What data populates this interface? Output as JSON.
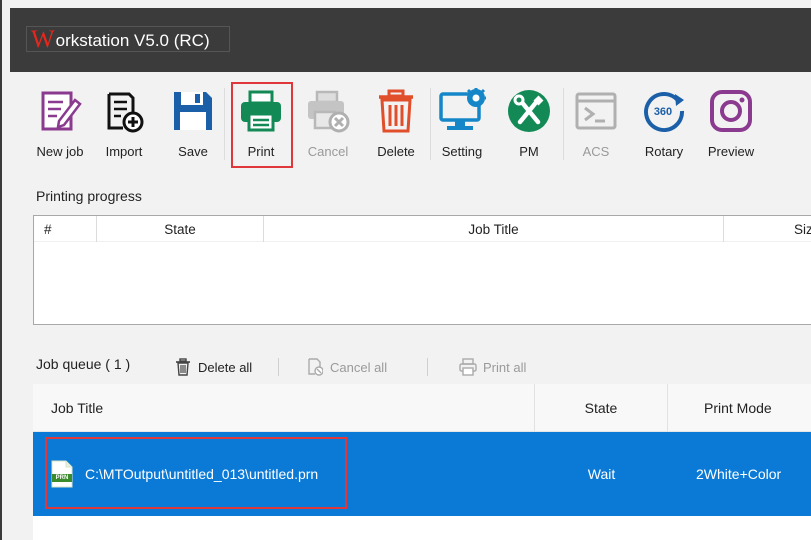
{
  "window": {
    "title_initial": "W",
    "title_rest": "orkstation V5.0 (RC)"
  },
  "toolbar": {
    "items": [
      {
        "label": "New job",
        "icon": "new-job-icon",
        "enabled": true
      },
      {
        "label": "Import",
        "icon": "import-icon",
        "enabled": true
      },
      {
        "label": "Save",
        "icon": "save-icon",
        "enabled": true
      },
      {
        "label": "Print",
        "icon": "printer-icon",
        "enabled": true
      },
      {
        "label": "Cancel",
        "icon": "cancel-print-icon",
        "enabled": false
      },
      {
        "label": "Delete",
        "icon": "trash-icon",
        "enabled": true
      },
      {
        "label": "Setting",
        "icon": "monitor-gear-icon",
        "enabled": true
      },
      {
        "label": "PM",
        "icon": "tools-icon",
        "enabled": true
      },
      {
        "label": "ACS",
        "icon": "terminal-icon",
        "enabled": false
      },
      {
        "label": "Rotary",
        "icon": "rotate-360-icon",
        "enabled": true
      },
      {
        "label": "Preview",
        "icon": "camera-icon",
        "enabled": true
      }
    ]
  },
  "progress": {
    "label": "Printing progress",
    "columns": [
      "#",
      "State",
      "Job Title",
      "Size"
    ]
  },
  "queue": {
    "label": "Job queue ( 1 )",
    "delete_all": "Delete all",
    "cancel_all": "Cancel all",
    "print_all": "Print all",
    "columns": [
      "Job Title",
      "State",
      "Print Mode"
    ],
    "rows": [
      {
        "title": "C:\\MTOutput\\untitled_013\\untitled.prn",
        "state": "Wait",
        "mode": "2White+Color",
        "icon_text": "PRN"
      }
    ]
  },
  "colors": {
    "accent_purple": "#8a3b8f",
    "accent_blue": "#1b5fa8",
    "accent_green": "#138a55",
    "accent_red": "#e0373b",
    "accent_orange": "#e04e2a",
    "accent_teal": "#1587c8",
    "selection_blue": "#0b79d6"
  }
}
